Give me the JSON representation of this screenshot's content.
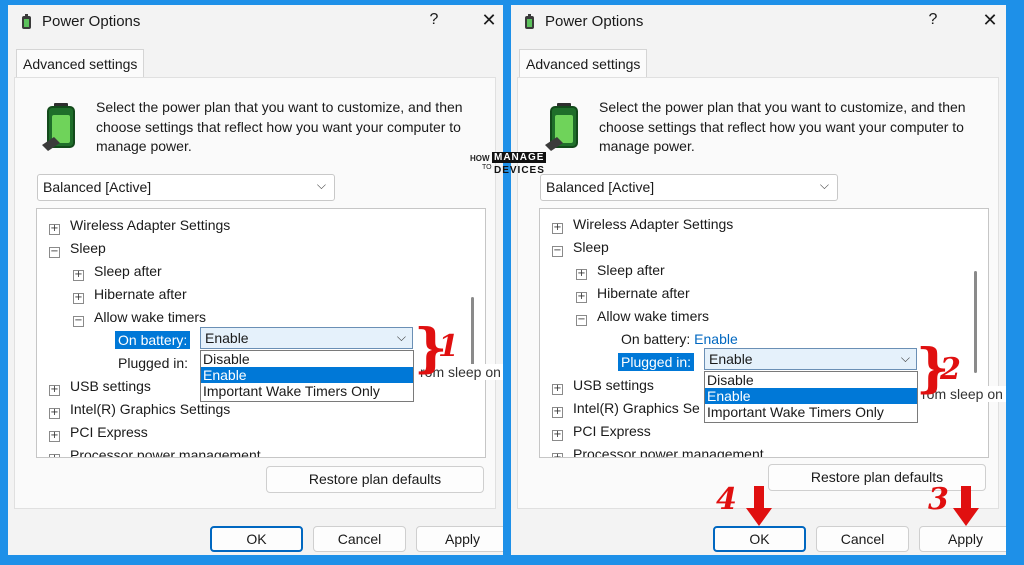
{
  "watermark": {
    "how": "HOW",
    "to": "TO",
    "manage": "MANAGE",
    "devices": "DEVICES"
  },
  "left_dialog": {
    "title": "Power Options",
    "help": "?",
    "close": "✕",
    "tab": "Advanced settings",
    "description": "Select the power plan that you want to customize, and then choose settings that reflect how you want your computer to manage power.",
    "plan": "Balanced [Active]",
    "tree": {
      "wireless": "Wireless Adapter Settings",
      "sleep": "Sleep",
      "sleep_after": "Sleep after",
      "hibernate_after": "Hibernate after",
      "allow_wake": "Allow wake timers",
      "on_battery": "On battery:",
      "plugged_in": "Plugged in:",
      "usb": "USB settings",
      "intel": "Intel(R) Graphics Settings",
      "pci": "PCI Express",
      "processor": "Processor power management",
      "bg_fragment": "rom sleep on"
    },
    "combo_value": "Enable",
    "options": [
      "Disable",
      "Enable",
      "Important Wake Timers Only"
    ],
    "restore": "Restore plan defaults",
    "ok": "OK",
    "cancel": "Cancel",
    "apply": "Apply",
    "step": "1"
  },
  "right_dialog": {
    "title": "Power Options",
    "help": "?",
    "close": "✕",
    "tab": "Advanced settings",
    "description": "Select the power plan that you want to customize, and then choose settings that reflect how you want your computer to manage power.",
    "plan": "Balanced [Active]",
    "tree": {
      "wireless": "Wireless Adapter Settings",
      "sleep": "Sleep",
      "sleep_after": "Sleep after",
      "hibernate_after": "Hibernate after",
      "allow_wake": "Allow wake timers",
      "on_battery": "On battery:",
      "on_battery_value": "Enable",
      "plugged_in": "Plugged in:",
      "usb": "USB settings",
      "intel": "Intel(R) Graphics Se",
      "pci": "PCI Express",
      "processor": "Processor power management",
      "bg_fragment": "rom sleep on"
    },
    "combo_value": "Enable",
    "options": [
      "Disable",
      "Enable",
      "Important Wake Timers Only"
    ],
    "restore": "Restore plan defaults",
    "ok": "OK",
    "cancel": "Cancel",
    "apply": "Apply",
    "step": "2",
    "step_ok": "4",
    "step_apply": "3"
  },
  "colors": {
    "background": "#1e90e8",
    "selection": "#0078d7",
    "annotation": "#e01010",
    "link": "#0067c0"
  }
}
